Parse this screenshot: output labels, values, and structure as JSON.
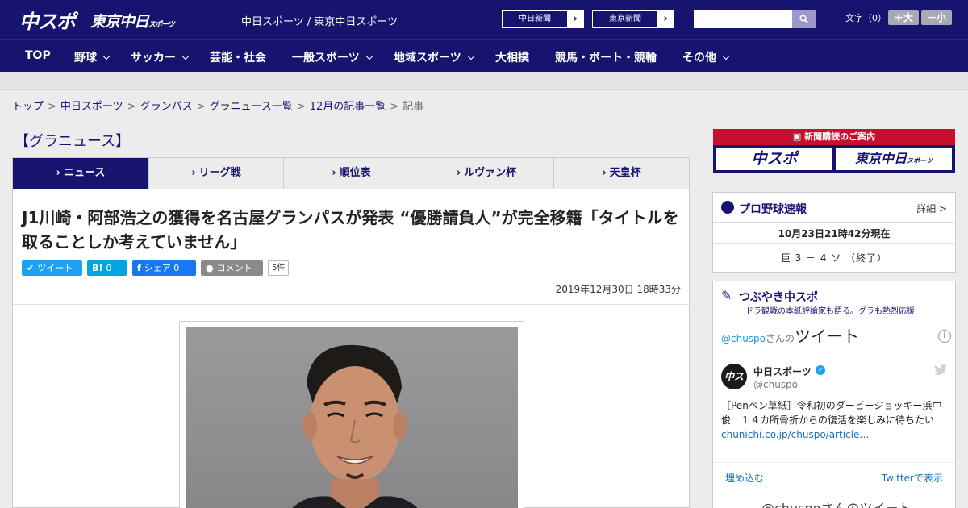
{
  "header": {
    "logo_chuspo": "中スポ",
    "logo_tokyo": "東京中日",
    "logo_tokyo_suffix": "スポーツ",
    "site_names": "中日スポーツ / 東京中日スポーツ",
    "paper1": "中日新聞",
    "paper2": "東京新聞",
    "search_placeholder": "",
    "fontsize_label": "文字（0）",
    "font_larger": "＋大",
    "font_smaller": "－小"
  },
  "nav": [
    "TOP",
    "野球",
    "サッカー",
    "芸能・社会",
    "一般スポーツ",
    "地域スポーツ",
    "大相撲",
    "競馬・ボート・競輪",
    "その他"
  ],
  "breadcrumb": [
    "トップ",
    "中日スポーツ",
    "グランパス",
    "グラニュース一覧",
    "12月の記事一覧",
    "記事"
  ],
  "section_title": "【グラニュース】",
  "tabs": [
    "ニュース",
    "リーグ戦",
    "順位表",
    "ルヴァン杯",
    "天皇杯"
  ],
  "article": {
    "headline": "J1川崎・阿部浩之の獲得を名古屋グランパスが発表 “優勝請負人”が完全移籍「タイトルを取ることしか考えていません」",
    "share": {
      "tweet": "ツイート",
      "hatena": "0",
      "facebook": "シェア 0",
      "comment": "コメント",
      "comment_count": "5件"
    },
    "date": "2019年12月30日 18時33分"
  },
  "sidebar": {
    "subscribe_title": "新聞購読のご案内",
    "subscribe_chuspo": "中スポ",
    "subscribe_tokyo": "東京中日",
    "subscribe_tokyo_suffix": "スポーツ",
    "baseball_title": "プロ野球速報",
    "baseball_detail": "詳細 >",
    "baseball_time": "10月23日21時42分現在",
    "baseball_score": "巨 3 － 4 ソ （終了）",
    "tsubuyaki_title": "つぶやき中スポ",
    "tsubuyaki_sub": "ドラ観戦の本紙評論家も語る。グラも熱烈応援",
    "tweets_handle_prefix": "@chuspo",
    "tweets_handle_suffix": "さんの",
    "tweets_big": "ツイート",
    "tweet_user": "中日スポーツ",
    "tweet_handle": "@chuspo",
    "tweet_text": "［Penペン草紙］令和初のダービージョッキー浜中俊　１４カ所骨折からの復活を楽しみに待ちたい",
    "tweet_link": "chunichi.co.jp/chuspo/article…",
    "embed": "埋め込む",
    "view_on_twitter": "Twitterで表示",
    "footer_partial": "@chuspoさんのツイート"
  }
}
